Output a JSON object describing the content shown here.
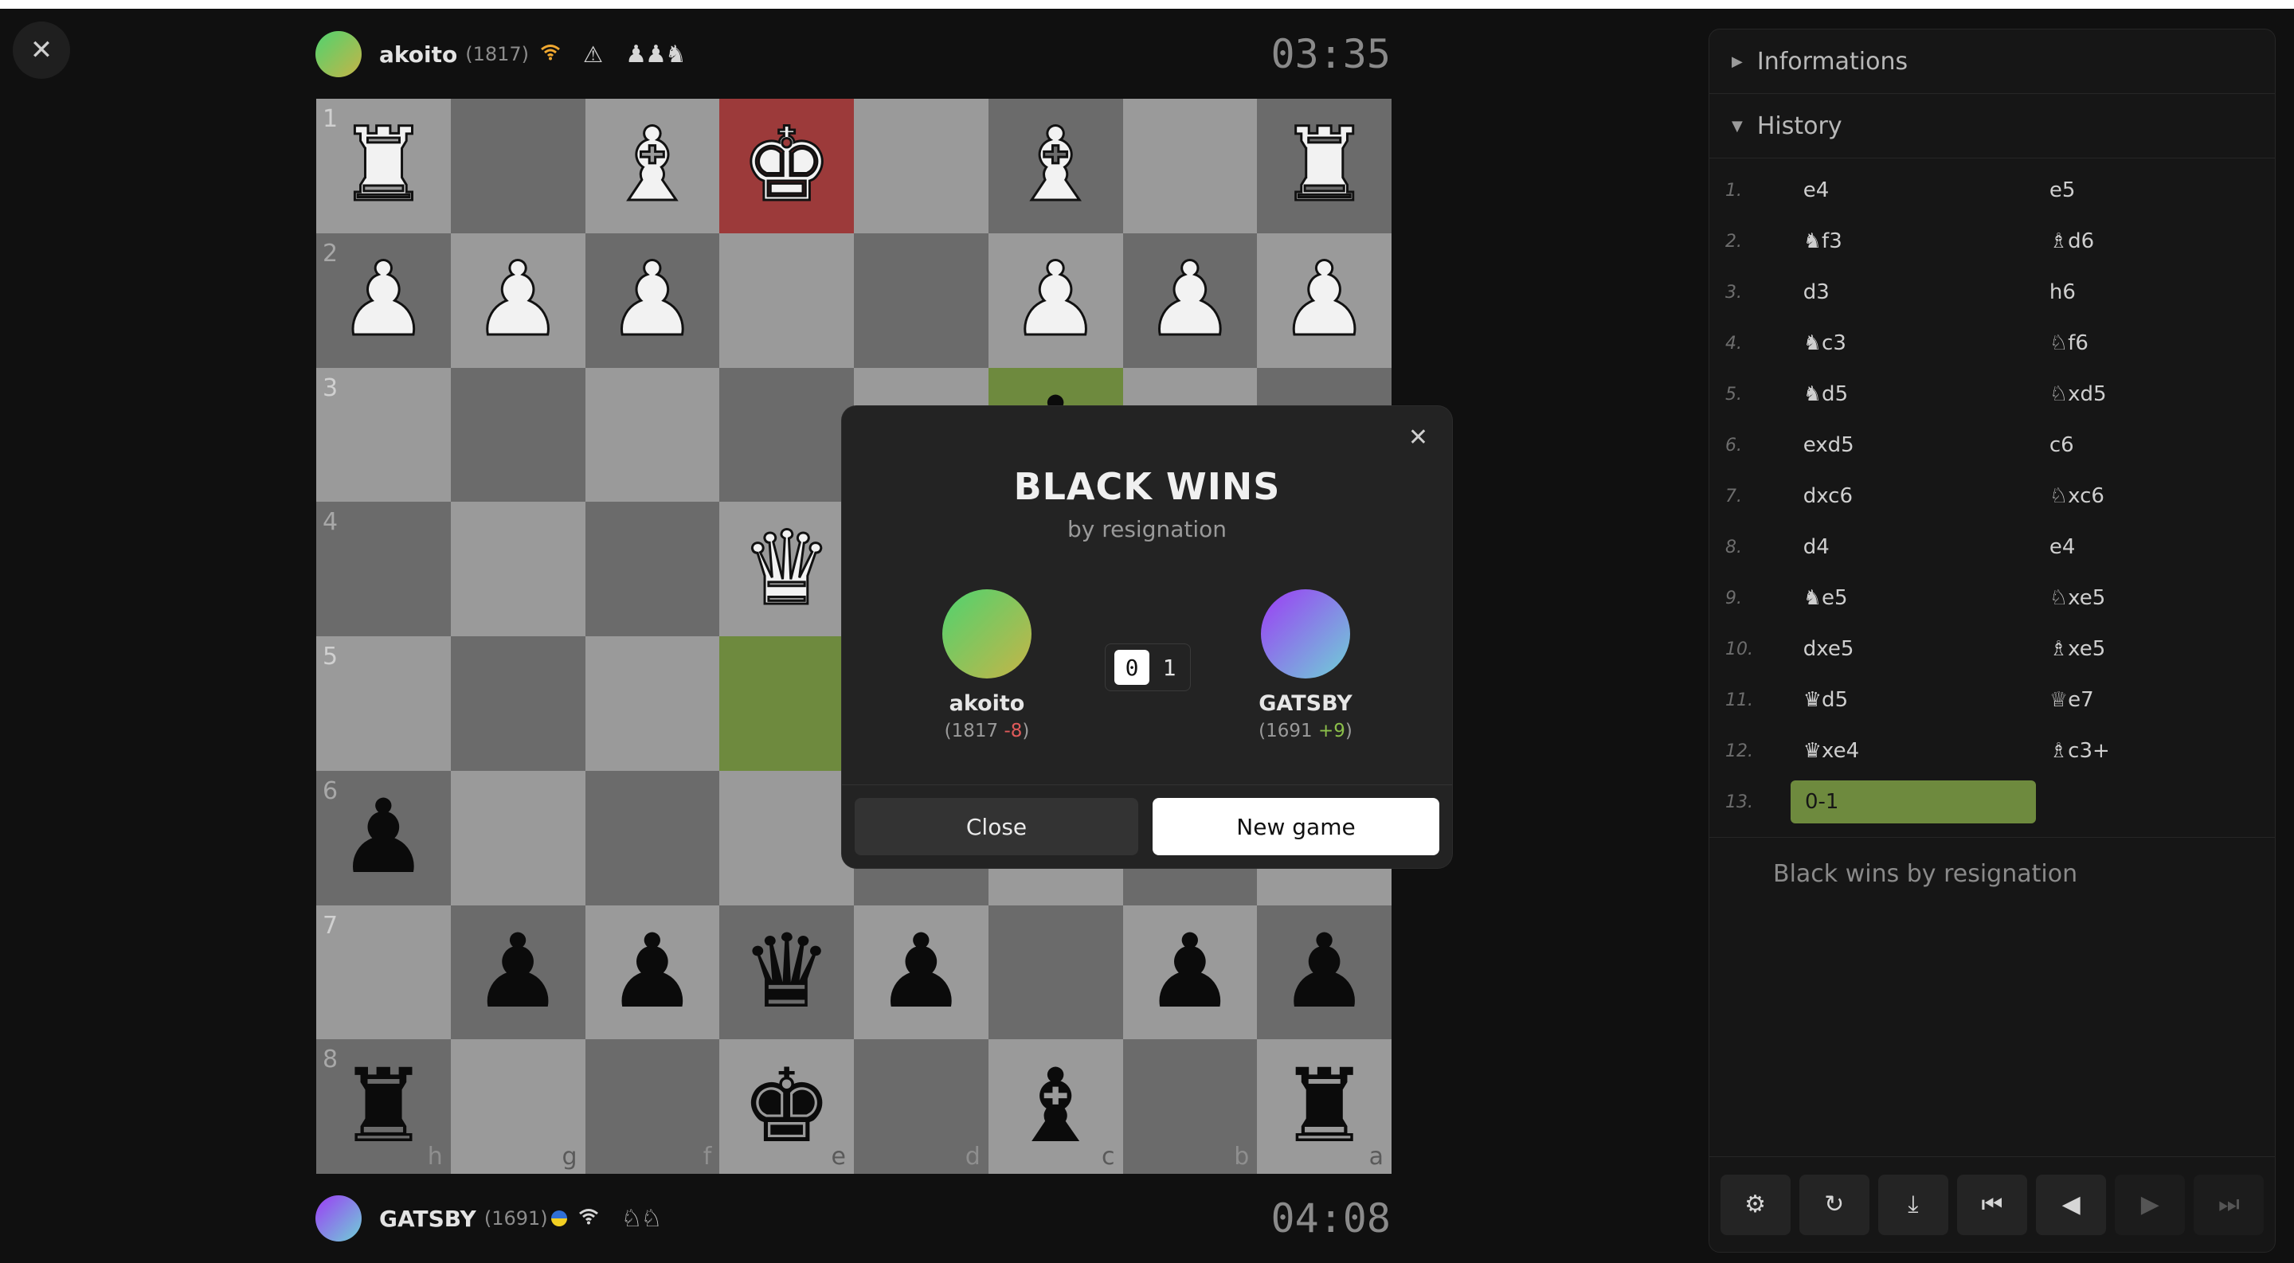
{
  "top_player": {
    "name": "akoito",
    "rating": "(1817)",
    "clock": "03:35",
    "captured": "♟♟♞"
  },
  "bottom_player": {
    "name": "GATSBY",
    "rating": "(1691)",
    "clock": "04:08",
    "captured": "♘♘"
  },
  "board": {
    "squares": [
      {
        "p": "♜",
        "c": "w",
        "r": "1"
      },
      {
        "p": "",
        "c": "",
        "r": ""
      },
      {
        "p": "♝",
        "c": "w"
      },
      {
        "p": "♚",
        "c": "w",
        "s": "check"
      },
      {
        "p": ""
      },
      {
        "p": "♝",
        "c": "w"
      },
      {
        "p": ""
      },
      {
        "p": "♜",
        "c": "w"
      },
      {
        "p": "♟",
        "c": "w",
        "r": "2"
      },
      {
        "p": "♟",
        "c": "w"
      },
      {
        "p": "♟",
        "c": "w"
      },
      {
        "p": ""
      },
      {
        "p": ""
      },
      {
        "p": "♟",
        "c": "w"
      },
      {
        "p": "♟",
        "c": "w"
      },
      {
        "p": "♟",
        "c": "w"
      },
      {
        "p": "",
        "r": "3"
      },
      {
        "p": ""
      },
      {
        "p": ""
      },
      {
        "p": ""
      },
      {
        "p": ""
      },
      {
        "p": "♝",
        "c": "b",
        "s": "hl"
      },
      {
        "p": ""
      },
      {
        "p": ""
      },
      {
        "p": "",
        "r": "4"
      },
      {
        "p": ""
      },
      {
        "p": ""
      },
      {
        "p": "♛",
        "c": "w"
      },
      {
        "p": ""
      },
      {
        "p": ""
      },
      {
        "p": ""
      },
      {
        "p": ""
      },
      {
        "p": "",
        "r": "5"
      },
      {
        "p": ""
      },
      {
        "p": ""
      },
      {
        "p": "",
        "s": "hl"
      },
      {
        "p": ""
      },
      {
        "p": ""
      },
      {
        "p": ""
      },
      {
        "p": ""
      },
      {
        "p": "♟",
        "c": "b",
        "r": "6"
      },
      {
        "p": ""
      },
      {
        "p": ""
      },
      {
        "p": ""
      },
      {
        "p": ""
      },
      {
        "p": ""
      },
      {
        "p": ""
      },
      {
        "p": ""
      },
      {
        "p": "",
        "r": "7"
      },
      {
        "p": "♟",
        "c": "b"
      },
      {
        "p": "♟",
        "c": "b"
      },
      {
        "p": "♛",
        "c": "b"
      },
      {
        "p": "♟",
        "c": "b"
      },
      {
        "p": ""
      },
      {
        "p": "♟",
        "c": "b"
      },
      {
        "p": "♟",
        "c": "b"
      },
      {
        "p": "♜",
        "c": "b",
        "r": "8",
        "f": "h"
      },
      {
        "p": "",
        "f": "g"
      },
      {
        "p": "",
        "f": "f"
      },
      {
        "p": "♚",
        "c": "b",
        "f": "e"
      },
      {
        "p": "",
        "f": "d"
      },
      {
        "p": "♝",
        "c": "b",
        "f": "c"
      },
      {
        "p": "",
        "f": "b"
      },
      {
        "p": "♜",
        "c": "b",
        "f": "a"
      }
    ]
  },
  "sidebar": {
    "informations_label": "Informations",
    "history_label": "History",
    "moves": [
      {
        "n": "1.",
        "w": "e4",
        "b": "e5"
      },
      {
        "n": "2.",
        "w": "♞f3",
        "b": "♗d6"
      },
      {
        "n": "3.",
        "w": "d3",
        "b": "h6"
      },
      {
        "n": "4.",
        "w": "♞c3",
        "b": "♘f6"
      },
      {
        "n": "5.",
        "w": "♞d5",
        "b": "♘xd5"
      },
      {
        "n": "6.",
        "w": "exd5",
        "b": "c6"
      },
      {
        "n": "7.",
        "w": "dxc6",
        "b": "♘xc6"
      },
      {
        "n": "8.",
        "w": "d4",
        "b": "e4"
      },
      {
        "n": "9.",
        "w": "♞e5",
        "b": "♘xe5"
      },
      {
        "n": "10.",
        "w": "dxe5",
        "b": "♗xe5"
      },
      {
        "n": "11.",
        "w": "♛d5",
        "b": "♕e7"
      },
      {
        "n": "12.",
        "w": "♛xe4",
        "b": "♗c3+"
      }
    ],
    "result_num": "13.",
    "result_move": "0-1",
    "result_text": "Black wins by resignation"
  },
  "modal": {
    "title": "BLACK WINS",
    "subtitle": "by resignation",
    "left": {
      "name": "akoito",
      "rating_prefix": "(1817 ",
      "rating_change": "-8",
      "rating_suffix": ")"
    },
    "right": {
      "name": "GATSBY",
      "rating_prefix": "(1691 ",
      "rating_change": "+9",
      "rating_suffix": ")"
    },
    "score_white": "0",
    "score_black": "1",
    "close_label": "Close",
    "new_game_label": "New game"
  },
  "colors": {
    "highlight": "#6e8a3e",
    "check": "#9c3a3a",
    "light_square": "#9a9a9a",
    "dark_square": "#6b6b6b"
  }
}
